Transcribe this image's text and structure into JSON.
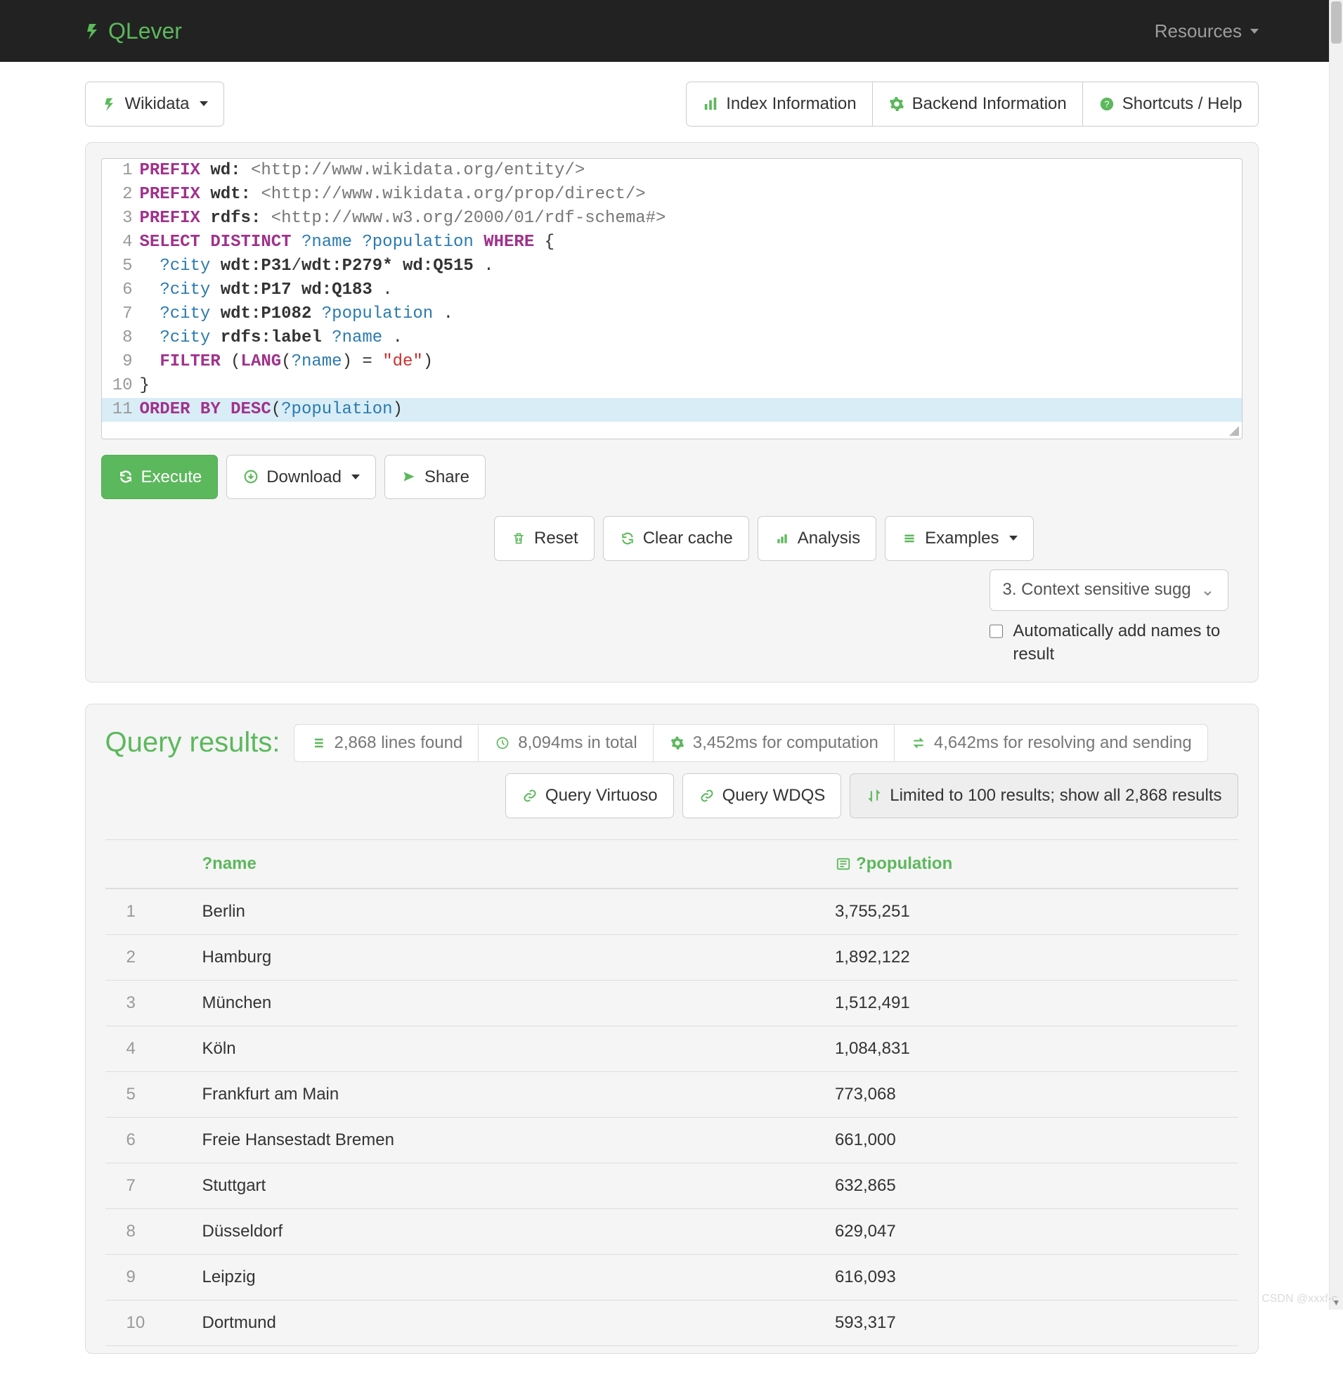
{
  "nav": {
    "brand": "QLever",
    "resources": "Resources"
  },
  "topbar": {
    "dataset_label": "Wikidata",
    "index_info": "Index Information",
    "backend_info": "Backend Information",
    "shortcuts": "Shortcuts / Help"
  },
  "code": {
    "lines": [
      {
        "n": "1",
        "tokens": [
          {
            "t": "PREFIX",
            "c": "kw-prefix"
          },
          {
            "t": " "
          },
          {
            "t": "wd:",
            "c": "pname"
          },
          {
            "t": " "
          },
          {
            "t": "<http://www.wikidata.org/entity/>",
            "c": "uri"
          }
        ]
      },
      {
        "n": "2",
        "tokens": [
          {
            "t": "PREFIX",
            "c": "kw-prefix"
          },
          {
            "t": " "
          },
          {
            "t": "wdt:",
            "c": "pname"
          },
          {
            "t": " "
          },
          {
            "t": "<http://www.wikidata.org/prop/direct/>",
            "c": "uri"
          }
        ]
      },
      {
        "n": "3",
        "tokens": [
          {
            "t": "PREFIX",
            "c": "kw-prefix"
          },
          {
            "t": " "
          },
          {
            "t": "rdfs:",
            "c": "pname"
          },
          {
            "t": " "
          },
          {
            "t": "<http://www.w3.org/2000/01/rdf-schema#>",
            "c": "uri"
          }
        ]
      },
      {
        "n": "4",
        "tokens": [
          {
            "t": "SELECT DISTINCT",
            "c": "kw-select"
          },
          {
            "t": " "
          },
          {
            "t": "?name",
            "c": "var"
          },
          {
            "t": " "
          },
          {
            "t": "?population",
            "c": "var"
          },
          {
            "t": " "
          },
          {
            "t": "WHERE",
            "c": "kw-select"
          },
          {
            "t": " {",
            "c": "punct"
          }
        ]
      },
      {
        "n": "5",
        "tokens": [
          {
            "t": "  "
          },
          {
            "t": "?city",
            "c": "var"
          },
          {
            "t": " "
          },
          {
            "t": "wdt:P31",
            "c": "pname"
          },
          {
            "t": "/",
            "c": "punct"
          },
          {
            "t": "wdt:P279*",
            "c": "pname"
          },
          {
            "t": " "
          },
          {
            "t": "wd:Q515",
            "c": "pname"
          },
          {
            "t": " .",
            "c": "punct"
          }
        ]
      },
      {
        "n": "6",
        "tokens": [
          {
            "t": "  "
          },
          {
            "t": "?city",
            "c": "var"
          },
          {
            "t": " "
          },
          {
            "t": "wdt:P17",
            "c": "pname"
          },
          {
            "t": " "
          },
          {
            "t": "wd:Q183",
            "c": "pname"
          },
          {
            "t": " .",
            "c": "punct"
          }
        ]
      },
      {
        "n": "7",
        "tokens": [
          {
            "t": "  "
          },
          {
            "t": "?city",
            "c": "var"
          },
          {
            "t": " "
          },
          {
            "t": "wdt:P1082",
            "c": "pname"
          },
          {
            "t": " "
          },
          {
            "t": "?population",
            "c": "var"
          },
          {
            "t": " .",
            "c": "punct"
          }
        ]
      },
      {
        "n": "8",
        "tokens": [
          {
            "t": "  "
          },
          {
            "t": "?city",
            "c": "var"
          },
          {
            "t": " "
          },
          {
            "t": "rdfs:label",
            "c": "pname"
          },
          {
            "t": " "
          },
          {
            "t": "?name",
            "c": "var"
          },
          {
            "t": " .",
            "c": "punct"
          }
        ]
      },
      {
        "n": "9",
        "tokens": [
          {
            "t": "  "
          },
          {
            "t": "FILTER",
            "c": "kw-filter"
          },
          {
            "t": " (",
            "c": "punct"
          },
          {
            "t": "LANG",
            "c": "kw-filter"
          },
          {
            "t": "(",
            "c": "punct"
          },
          {
            "t": "?name",
            "c": "var"
          },
          {
            "t": ") = ",
            "c": "punct"
          },
          {
            "t": "\"de\"",
            "c": "lit"
          },
          {
            "t": ")",
            "c": "punct"
          }
        ]
      },
      {
        "n": "10",
        "tokens": [
          {
            "t": "}",
            "c": "punct"
          }
        ]
      },
      {
        "n": "11",
        "hl": true,
        "tokens": [
          {
            "t": "ORDER BY DESC",
            "c": "kw-orderby"
          },
          {
            "t": "(",
            "c": "punct"
          },
          {
            "t": "?population",
            "c": "var"
          },
          {
            "t": ")",
            "c": "punct"
          }
        ]
      }
    ]
  },
  "actions": {
    "execute": "Execute",
    "download": "Download",
    "share": "Share",
    "reset": "Reset",
    "clear_cache": "Clear cache",
    "analysis": "Analysis",
    "examples": "Examples",
    "suggest_mode": "3. Context sensitive sugg",
    "auto_names": "Automatically add names to result"
  },
  "results": {
    "title": "Query results:",
    "lines_found": "2,868 lines found",
    "total_time": "8,094ms in total",
    "compute_time": "3,452ms for computation",
    "resolve_time": "4,642ms for resolving and sending",
    "query_virtuoso": "Query Virtuoso",
    "query_wdqs": "Query WDQS",
    "limited": "Limited to 100 results; show all 2,868 results",
    "columns": {
      "name": "?name",
      "population": "?population"
    },
    "rows": [
      {
        "i": "1",
        "name": "Berlin",
        "pop": "3,755,251"
      },
      {
        "i": "2",
        "name": "Hamburg",
        "pop": "1,892,122"
      },
      {
        "i": "3",
        "name": "München",
        "pop": "1,512,491"
      },
      {
        "i": "4",
        "name": "Köln",
        "pop": "1,084,831"
      },
      {
        "i": "5",
        "name": "Frankfurt am Main",
        "pop": "773,068"
      },
      {
        "i": "6",
        "name": "Freie Hansestadt Bremen",
        "pop": "661,000"
      },
      {
        "i": "7",
        "name": "Stuttgart",
        "pop": "632,865"
      },
      {
        "i": "8",
        "name": "Düsseldorf",
        "pop": "629,047"
      },
      {
        "i": "9",
        "name": "Leipzig",
        "pop": "616,093"
      },
      {
        "i": "10",
        "name": "Dortmund",
        "pop": "593,317"
      }
    ]
  },
  "watermark": "CSDN @xxxf-c"
}
